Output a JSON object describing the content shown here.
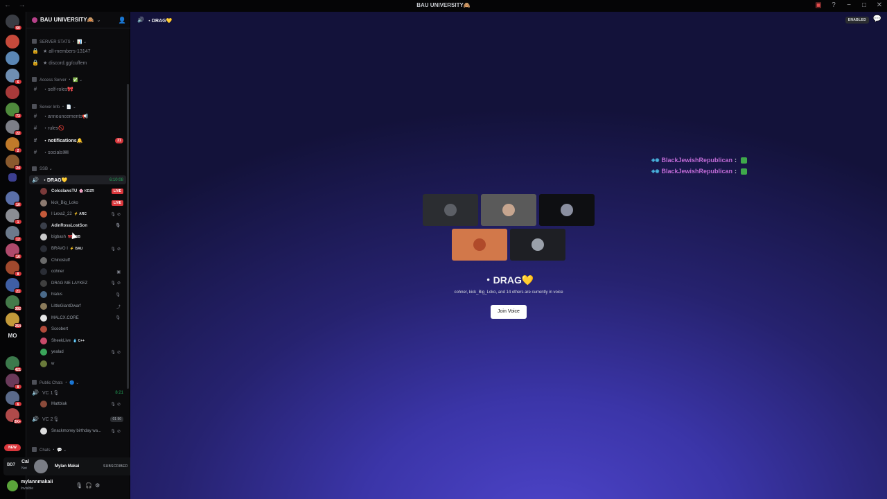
{
  "titlebar": {
    "nav": "← →",
    "title": "BAU UNIVERSITY🙈",
    "inbox_icon": "inbox-icon",
    "help_icon": "help-icon",
    "min": "−",
    "max": "□",
    "close": "✕"
  },
  "rail": {
    "home_badge": "60",
    "servers": [
      {
        "color": "#c64a3b",
        "badge": ""
      },
      {
        "color": "#5b87b5",
        "badge": ""
      },
      {
        "color": "#6f8fb3",
        "badge": "6"
      },
      {
        "color": "#a83a3a",
        "badge": ""
      },
      {
        "color": "#4f8a3c",
        "badge": "73"
      },
      {
        "color": "#7d7f87",
        "badge": "22"
      },
      {
        "color": "#c07a2a",
        "badge": "2"
      },
      {
        "color": "#8a5a2e",
        "badge": "24"
      },
      {
        "color": "#3c3f8f",
        "badge": ""
      },
      {
        "color": "#5a6fa8",
        "badge": "10"
      },
      {
        "color": "#8b8d94",
        "badge": "1"
      },
      {
        "color": "#6c7a8c",
        "badge": "12"
      },
      {
        "color": "#b04a6c",
        "badge": "16"
      },
      {
        "color": "#a1492d",
        "badge": "8"
      },
      {
        "color": "#3f5fa5",
        "badge": "21"
      },
      {
        "color": "#447a4a",
        "badge": "302"
      },
      {
        "color": "#c49a3a",
        "badge": "254"
      }
    ],
    "mo_label": "MO",
    "more_badges": [
      "421",
      "8",
      "6",
      "2K+"
    ],
    "new_label": "NEW"
  },
  "guild": {
    "name": "BAU UNIVERSITY🙈",
    "chevron": "⌄"
  },
  "channels": [
    {
      "type": "cat",
      "label": "SERVER STATS ・ 📊 ⌄"
    },
    {
      "type": "locked",
      "label": "★ all-members-13147"
    },
    {
      "type": "locked",
      "label": "★ discord.gg/cuffem"
    },
    {
      "type": "cat",
      "label": "Access Server ・ ✅ ⌄"
    },
    {
      "type": "text",
      "label": "・self-roles🎀"
    },
    {
      "type": "cat",
      "label": "Server Info ・ 📄 ⌄"
    },
    {
      "type": "text",
      "label": "・announcements📢"
    },
    {
      "type": "text",
      "label": "・rules🚫"
    },
    {
      "type": "text",
      "label": "・notifications🔔",
      "bold": true,
      "badge": "21"
    },
    {
      "type": "text",
      "label": "・socials🎟"
    },
    {
      "type": "cat",
      "label": "SSB ⌄"
    }
  ],
  "drag_channel": {
    "label": "・DRAG💛",
    "timer": "6:10:08"
  },
  "voice_users": [
    {
      "name": "CoIcsIawsTU",
      "tag": "🌸 KDZR",
      "live": "LIVE",
      "color": "#7a3a3a",
      "bright": true
    },
    {
      "name": "kick_Big_Loko",
      "tag": "",
      "live": "LIVE",
      "color": "#8c7a70",
      "icons": "🎙⊘▣"
    },
    {
      "name": "I Lexa2_22",
      "tag": "⚡ ARC",
      "color": "#c45a3a",
      "icons": "🎙⊘"
    },
    {
      "name": "AdinRossLostSon",
      "tag": "",
      "color": "#3a3f4a",
      "bright": true,
      "icons": "🎙"
    },
    {
      "name": "bigbash",
      "tag": "🎀 SSB",
      "color": "#c9c9c9"
    },
    {
      "name": "BRAVO I",
      "tag": "⚡ BAU",
      "color": "#2a2d35",
      "icons": "🎙⊘"
    },
    {
      "name": "Chinostuff",
      "tag": "",
      "color": "#6a6a6a"
    },
    {
      "name": "cohner",
      "tag": "",
      "color": "#2a2d35",
      "icons": "▣"
    },
    {
      "name": "DRAG ME LAYKEZ",
      "tag": "",
      "color": "#3f3f3f",
      "icons": "🎙⊘"
    },
    {
      "name": "hiatus",
      "tag": "",
      "color": "#4a6a8a",
      "icons": "🎙"
    },
    {
      "name": "LittleGiantDwarf",
      "tag": "",
      "color": "#8a7a5a",
      "icons": "⤴"
    },
    {
      "name": "MALCX.CORE",
      "tag": "",
      "color": "#e5e5e5",
      "icons": "🎙"
    },
    {
      "name": "Scoobert",
      "tag": "",
      "color": "#b04a3a"
    },
    {
      "name": "SheekLive",
      "tag": "💧 C++",
      "color": "#c94a6a"
    },
    {
      "name": "yealad",
      "tag": "",
      "color": "#3aa55a",
      "icons": "🎙⊘"
    },
    {
      "name": "w",
      "tag": "",
      "color": "#6a7a3a"
    }
  ],
  "public_chats": {
    "cat": "Public Chats ・ 🔵 ⌄",
    "vc1": {
      "label": "VC 1🎙",
      "timer": "8:21"
    },
    "vc1_user": {
      "name": "Mattblak",
      "color": "#8a4a3a",
      "icons": "🎙⊘"
    },
    "vc2": {
      "label": "VC 2🎙",
      "count": "01",
      "limit": "50"
    },
    "vc2_user": {
      "name": "Snackmoney birthday wa...",
      "color": "#dcdcdc",
      "icons": "🎙⊘"
    },
    "chats_cat": "Chats ・ 💬 ⌄"
  },
  "toast": {
    "logo": "BD7",
    "cal": "Cal",
    "not": "Not",
    "name": "Mylan Makai",
    "subscribed": "SUBSCRIBED",
    "bell_icon": "bell-icon"
  },
  "user": {
    "name": "mylannmakaii",
    "status": "Invisible",
    "mic": "🎙",
    "deafen": "🎧",
    "settings": "⚙"
  },
  "main": {
    "header_title": "・DRAG💛",
    "enabled_label": "ENABLED",
    "chat_lines": [
      {
        "name": "BlackJewishRepublican",
        "colon": ":"
      },
      {
        "name": "BlackJewishRepublican",
        "colon": ":"
      }
    ],
    "tiles": [
      {
        "bg": "#2b2d31",
        "av": "#5c5f66"
      },
      {
        "bg": "#5a5a5a",
        "av": "#c6a58f"
      },
      {
        "bg": "#0e0f12",
        "av": "#8a8fa0"
      },
      {
        "bg": "#d2784a",
        "av": "#b04a2a"
      },
      {
        "bg": "#1e1f24",
        "av": "#9aa0aa"
      }
    ],
    "vc_title": "・DRAG💛",
    "vc_subtitle": "cohner, kick_Big_Loko, and 14 others are currently in voice",
    "join_label": "Join Voice"
  }
}
